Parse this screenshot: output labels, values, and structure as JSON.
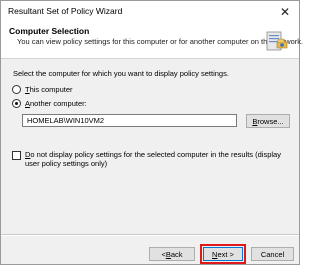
{
  "window": {
    "title": "Resultant Set of Policy Wizard",
    "close_glyph": "✕"
  },
  "header": {
    "title": "Computer Selection",
    "description": "You can view policy settings for this computer or for another computer on this network."
  },
  "main": {
    "prompt": "Select the computer for which you want to display policy settings.",
    "this_computer": {
      "prefix": "",
      "accel": "T",
      "rest": "his computer",
      "checked": false
    },
    "another_computer": {
      "prefix": "",
      "accel": "A",
      "rest": "nother computer:",
      "checked": true
    },
    "computer_value": "HOMELAB\\WIN10VM2",
    "browse": {
      "accel": "B",
      "rest": "rowse..."
    },
    "do_not_display": {
      "accel": "D",
      "rest": "o not display policy settings for the selected computer in the results (display user policy settings only)",
      "checked": false
    }
  },
  "footer": {
    "back": {
      "prefix": "< ",
      "accel": "B",
      "rest": "ack"
    },
    "next": {
      "accel": "N",
      "rest": "ext >"
    },
    "cancel": "Cancel"
  },
  "colors": {
    "highlight": "#e01a1a",
    "default_button_border": "#0078d7"
  }
}
